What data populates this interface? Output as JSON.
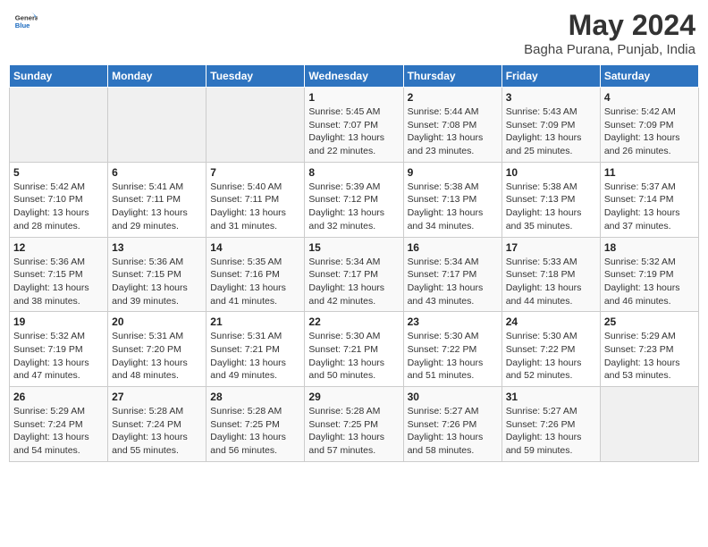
{
  "header": {
    "logo_general": "General",
    "logo_blue": "Blue",
    "title": "May 2024",
    "subtitle": "Bagha Purana, Punjab, India"
  },
  "weekdays": [
    "Sunday",
    "Monday",
    "Tuesday",
    "Wednesday",
    "Thursday",
    "Friday",
    "Saturday"
  ],
  "weeks": [
    [
      {
        "day": "",
        "info": ""
      },
      {
        "day": "",
        "info": ""
      },
      {
        "day": "",
        "info": ""
      },
      {
        "day": "1",
        "info": "Sunrise: 5:45 AM\nSunset: 7:07 PM\nDaylight: 13 hours\nand 22 minutes."
      },
      {
        "day": "2",
        "info": "Sunrise: 5:44 AM\nSunset: 7:08 PM\nDaylight: 13 hours\nand 23 minutes."
      },
      {
        "day": "3",
        "info": "Sunrise: 5:43 AM\nSunset: 7:09 PM\nDaylight: 13 hours\nand 25 minutes."
      },
      {
        "day": "4",
        "info": "Sunrise: 5:42 AM\nSunset: 7:09 PM\nDaylight: 13 hours\nand 26 minutes."
      }
    ],
    [
      {
        "day": "5",
        "info": "Sunrise: 5:42 AM\nSunset: 7:10 PM\nDaylight: 13 hours\nand 28 minutes."
      },
      {
        "day": "6",
        "info": "Sunrise: 5:41 AM\nSunset: 7:11 PM\nDaylight: 13 hours\nand 29 minutes."
      },
      {
        "day": "7",
        "info": "Sunrise: 5:40 AM\nSunset: 7:11 PM\nDaylight: 13 hours\nand 31 minutes."
      },
      {
        "day": "8",
        "info": "Sunrise: 5:39 AM\nSunset: 7:12 PM\nDaylight: 13 hours\nand 32 minutes."
      },
      {
        "day": "9",
        "info": "Sunrise: 5:38 AM\nSunset: 7:13 PM\nDaylight: 13 hours\nand 34 minutes."
      },
      {
        "day": "10",
        "info": "Sunrise: 5:38 AM\nSunset: 7:13 PM\nDaylight: 13 hours\nand 35 minutes."
      },
      {
        "day": "11",
        "info": "Sunrise: 5:37 AM\nSunset: 7:14 PM\nDaylight: 13 hours\nand 37 minutes."
      }
    ],
    [
      {
        "day": "12",
        "info": "Sunrise: 5:36 AM\nSunset: 7:15 PM\nDaylight: 13 hours\nand 38 minutes."
      },
      {
        "day": "13",
        "info": "Sunrise: 5:36 AM\nSunset: 7:15 PM\nDaylight: 13 hours\nand 39 minutes."
      },
      {
        "day": "14",
        "info": "Sunrise: 5:35 AM\nSunset: 7:16 PM\nDaylight: 13 hours\nand 41 minutes."
      },
      {
        "day": "15",
        "info": "Sunrise: 5:34 AM\nSunset: 7:17 PM\nDaylight: 13 hours\nand 42 minutes."
      },
      {
        "day": "16",
        "info": "Sunrise: 5:34 AM\nSunset: 7:17 PM\nDaylight: 13 hours\nand 43 minutes."
      },
      {
        "day": "17",
        "info": "Sunrise: 5:33 AM\nSunset: 7:18 PM\nDaylight: 13 hours\nand 44 minutes."
      },
      {
        "day": "18",
        "info": "Sunrise: 5:32 AM\nSunset: 7:19 PM\nDaylight: 13 hours\nand 46 minutes."
      }
    ],
    [
      {
        "day": "19",
        "info": "Sunrise: 5:32 AM\nSunset: 7:19 PM\nDaylight: 13 hours\nand 47 minutes."
      },
      {
        "day": "20",
        "info": "Sunrise: 5:31 AM\nSunset: 7:20 PM\nDaylight: 13 hours\nand 48 minutes."
      },
      {
        "day": "21",
        "info": "Sunrise: 5:31 AM\nSunset: 7:21 PM\nDaylight: 13 hours\nand 49 minutes."
      },
      {
        "day": "22",
        "info": "Sunrise: 5:30 AM\nSunset: 7:21 PM\nDaylight: 13 hours\nand 50 minutes."
      },
      {
        "day": "23",
        "info": "Sunrise: 5:30 AM\nSunset: 7:22 PM\nDaylight: 13 hours\nand 51 minutes."
      },
      {
        "day": "24",
        "info": "Sunrise: 5:30 AM\nSunset: 7:22 PM\nDaylight: 13 hours\nand 52 minutes."
      },
      {
        "day": "25",
        "info": "Sunrise: 5:29 AM\nSunset: 7:23 PM\nDaylight: 13 hours\nand 53 minutes."
      }
    ],
    [
      {
        "day": "26",
        "info": "Sunrise: 5:29 AM\nSunset: 7:24 PM\nDaylight: 13 hours\nand 54 minutes."
      },
      {
        "day": "27",
        "info": "Sunrise: 5:28 AM\nSunset: 7:24 PM\nDaylight: 13 hours\nand 55 minutes."
      },
      {
        "day": "28",
        "info": "Sunrise: 5:28 AM\nSunset: 7:25 PM\nDaylight: 13 hours\nand 56 minutes."
      },
      {
        "day": "29",
        "info": "Sunrise: 5:28 AM\nSunset: 7:25 PM\nDaylight: 13 hours\nand 57 minutes."
      },
      {
        "day": "30",
        "info": "Sunrise: 5:27 AM\nSunset: 7:26 PM\nDaylight: 13 hours\nand 58 minutes."
      },
      {
        "day": "31",
        "info": "Sunrise: 5:27 AM\nSunset: 7:26 PM\nDaylight: 13 hours\nand 59 minutes."
      },
      {
        "day": "",
        "info": ""
      }
    ]
  ]
}
